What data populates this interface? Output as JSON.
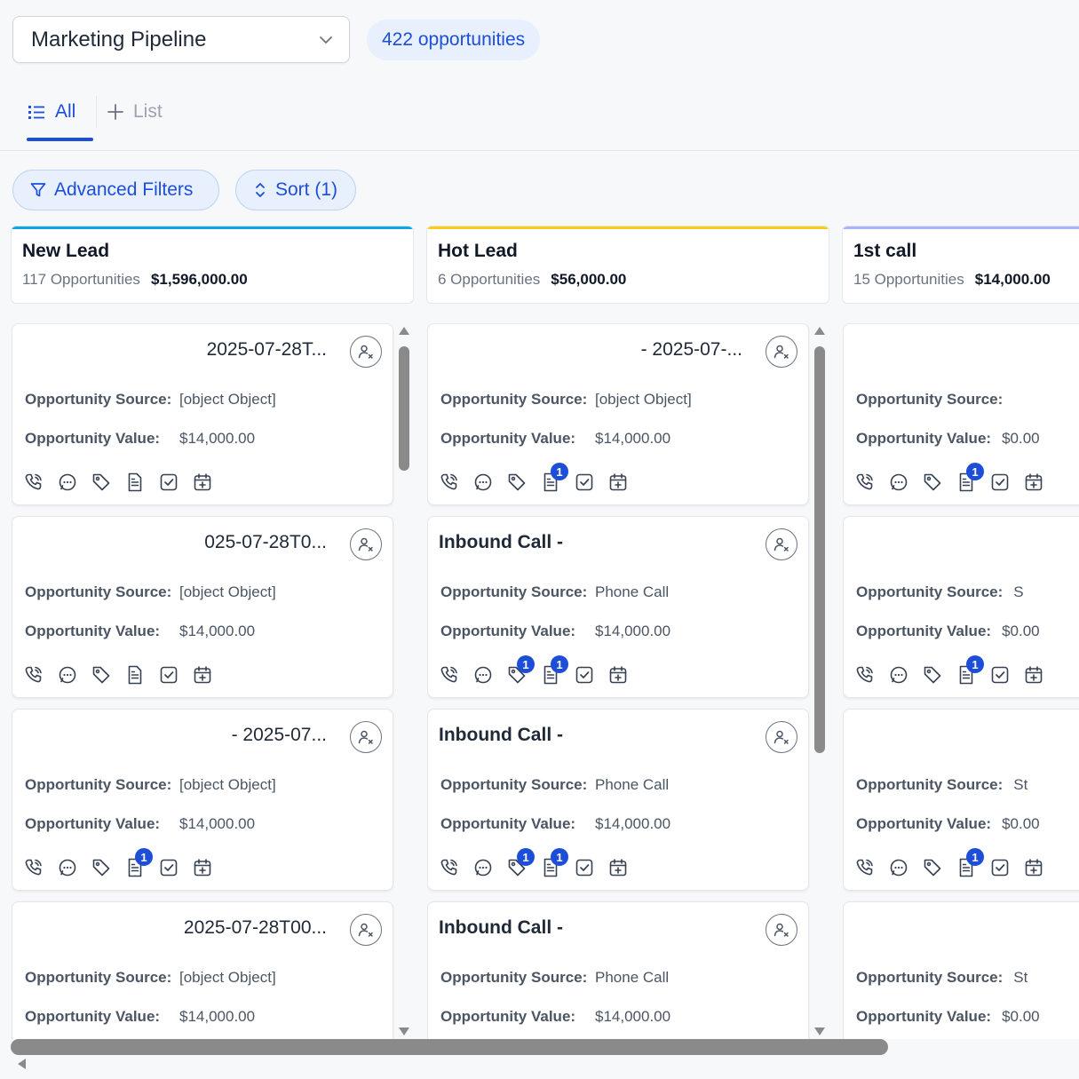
{
  "pipeline": {
    "selected": "Marketing Pipeline",
    "count_label": "422 opportunities"
  },
  "tabs": {
    "all": "All",
    "list": "List"
  },
  "filters": {
    "advanced": "Advanced Filters",
    "sort": "Sort (1)"
  },
  "stages": [
    {
      "name": "New Lead",
      "count": "117 Opportunities",
      "amount": "$1,596,000.00",
      "color": "#0ea5e9"
    },
    {
      "name": "Hot Lead",
      "count": "6 Opportunities",
      "amount": "$56,000.00",
      "color": "#facc15"
    },
    {
      "name": "1st call",
      "count": "15 Opportunities",
      "amount": "$14,000.00",
      "color": "#a5b4fc"
    }
  ],
  "labels": {
    "source": "Opportunity Source:",
    "value": "Opportunity Value:"
  },
  "columns": [
    [
      {
        "title": "2025-07-28T...",
        "source": "[object Object]",
        "value": "$14,000.00",
        "badges": []
      },
      {
        "title": "025-07-28T0...",
        "source": "[object Object]",
        "value": "$14,000.00",
        "badges": []
      },
      {
        "title": "- 2025-07...",
        "source": "[object Object]",
        "value": "$14,000.00",
        "badges": [
          {
            "icon": 3,
            "count": "1"
          }
        ]
      },
      {
        "title": "2025-07-28T00...",
        "source": "[object Object]",
        "value": "$14,000.00",
        "badges": []
      }
    ],
    [
      {
        "title": "- 2025-07-...",
        "source": "[object Object]",
        "value": "$14,000.00",
        "badges": [
          {
            "icon": 3,
            "count": "1"
          }
        ]
      },
      {
        "title": "Inbound Call -",
        "source": "Phone Call",
        "value": "$14,000.00",
        "badges": [
          {
            "icon": 2,
            "count": "1"
          },
          {
            "icon": 3,
            "count": "1"
          }
        ]
      },
      {
        "title": "Inbound Call -",
        "source": "Phone Call",
        "value": "$14,000.00",
        "badges": [
          {
            "icon": 2,
            "count": "1"
          },
          {
            "icon": 3,
            "count": "1"
          }
        ]
      },
      {
        "title": "Inbound Call -",
        "source": "Phone Call",
        "value": "$14,000.00",
        "badges": []
      }
    ],
    [
      {
        "title": "",
        "source": "",
        "value": "$0.00",
        "badges": [
          {
            "icon": 3,
            "count": "1"
          }
        ]
      },
      {
        "title": "",
        "source": "S",
        "value": "$0.00",
        "badges": [
          {
            "icon": 3,
            "count": "1"
          }
        ]
      },
      {
        "title": "",
        "source": "St",
        "value": "$0.00",
        "badges": [
          {
            "icon": 3,
            "count": "1"
          }
        ]
      },
      {
        "title": "",
        "source": "St",
        "value": "$0.00",
        "badges": []
      }
    ]
  ],
  "icons": [
    "phone-icon",
    "chat-icon",
    "tag-icon",
    "note-icon",
    "task-icon",
    "calendar-icon"
  ]
}
